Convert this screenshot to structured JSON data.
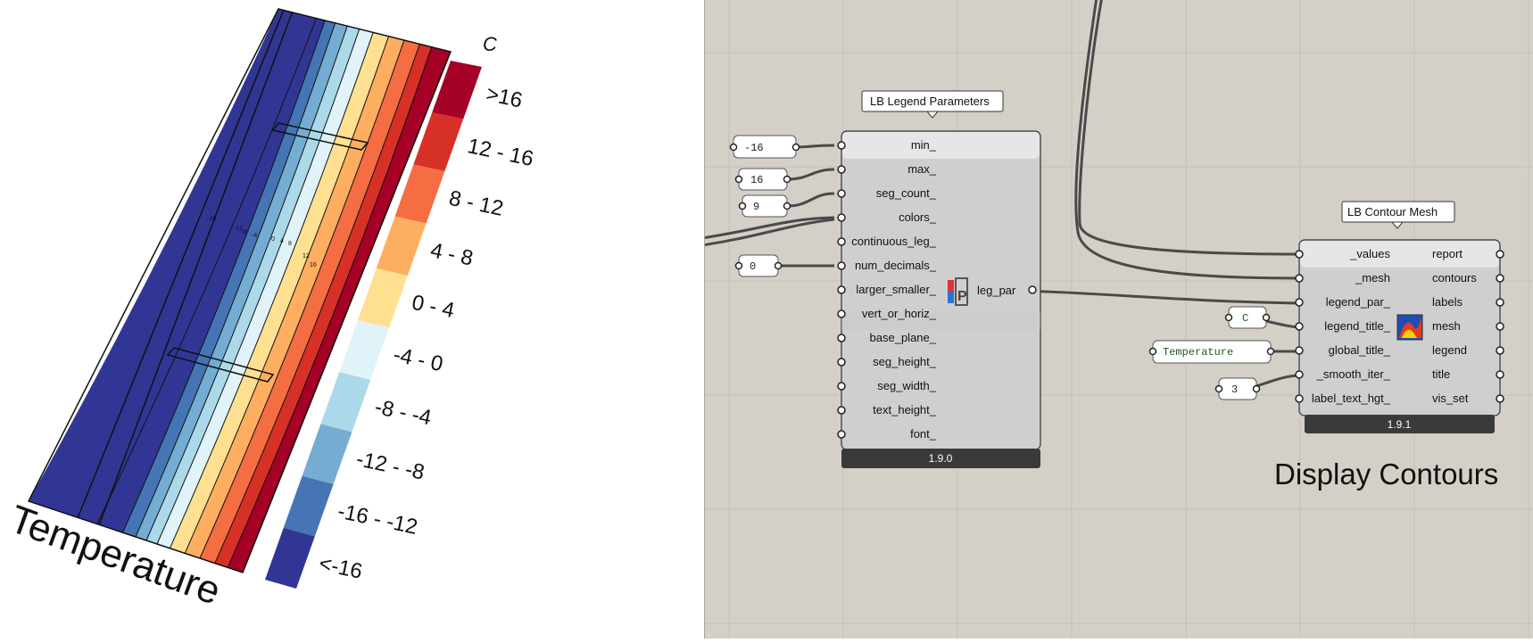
{
  "left_panel": {
    "plot_title": "Temperature",
    "legend": {
      "unit": "C",
      "labels": [
        ">16",
        "12 - 16",
        "8 - 12",
        "4 - 8",
        "0 - 4",
        "-4 - 0",
        "-8 - -4",
        "-12 - -8",
        "-16 - -12",
        "<-16"
      ],
      "colors": [
        "#a50026",
        "#d73027",
        "#f46d43",
        "#fdae61",
        "#fee090",
        "#e0f3f8",
        "#abd9e9",
        "#74add1",
        "#4575b4",
        "#313695"
      ]
    },
    "contour_labels": [
      "-16",
      "-12",
      "-8",
      "-4",
      "0",
      "4",
      "8",
      "12",
      "16"
    ]
  },
  "canvas": {
    "background": "#d4d0c8",
    "nodes": {
      "legend_params": {
        "title": "LB Legend Parameters",
        "version": "1.9.0",
        "icon": "ladybug-legend-parameters-icon",
        "inputs": [
          "min_",
          "max_",
          "seg_count_",
          "colors_",
          "continuous_leg_",
          "num_decimals_",
          "larger_smaller_",
          "vert_or_horiz_",
          "base_plane_",
          "seg_height_",
          "seg_width_",
          "text_height_",
          "font_"
        ],
        "output": "leg_par"
      },
      "contour_mesh": {
        "title": "LB Contour Mesh",
        "version": "1.9.1",
        "icon": "ladybug-contour-mesh-icon",
        "inputs": [
          "_values",
          "_mesh",
          "legend_par_",
          "legend_title_",
          "global_title_",
          "_smooth_iter_",
          "label_text_hgt_"
        ],
        "outputs": [
          "report",
          "contours",
          "labels",
          "mesh",
          "legend",
          "title",
          "vis_set"
        ]
      }
    },
    "panels": {
      "min": "-16",
      "max": "16",
      "seg_count": "9",
      "num_decimals": "0",
      "legend_title": "C",
      "global_title": "Temperature",
      "smooth_iter": "3"
    },
    "group_label": "Display Contours"
  }
}
